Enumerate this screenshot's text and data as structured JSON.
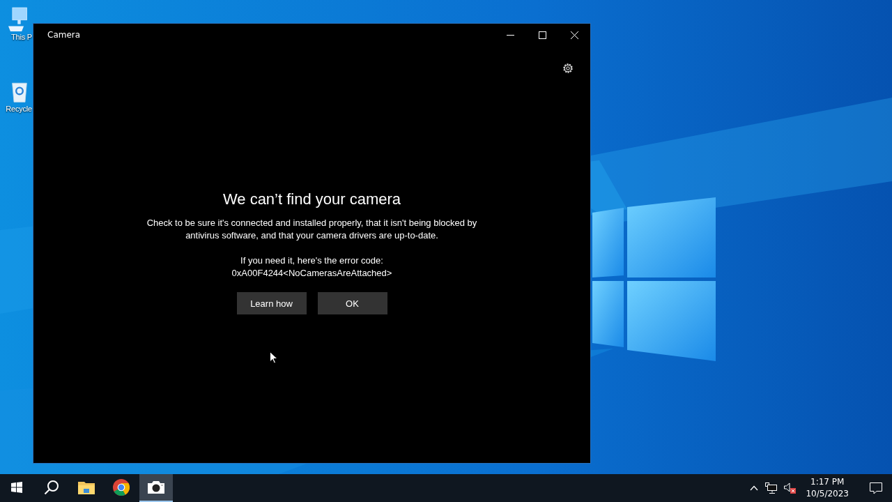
{
  "desktop": {
    "icons": [
      {
        "kind": "computer",
        "label": "This P"
      },
      {
        "kind": "recycle-bin",
        "label": "Recycle"
      }
    ]
  },
  "window": {
    "title": "Camera",
    "dialog": {
      "heading": "We can’t find your camera",
      "message": "Check to be sure it's connected and installed properly, that it isn't being blocked by antivirus software, and that your camera drivers are up-to-date.",
      "error_intro": "If you need it, here's the error code:",
      "error_code": "0xA00F4244<NoCamerasAreAttached>",
      "buttons": [
        "Learn how",
        "OK"
      ]
    }
  },
  "taskbar": {
    "apps": [
      {
        "kind": "start",
        "selected": false
      },
      {
        "kind": "search",
        "selected": false
      },
      {
        "kind": "folder",
        "selected": false
      },
      {
        "kind": "browser",
        "selected": false
      },
      {
        "kind": "camera",
        "selected": true
      }
    ],
    "tray": {
      "time": "1:17 PM",
      "date": "10/5/2023"
    }
  }
}
